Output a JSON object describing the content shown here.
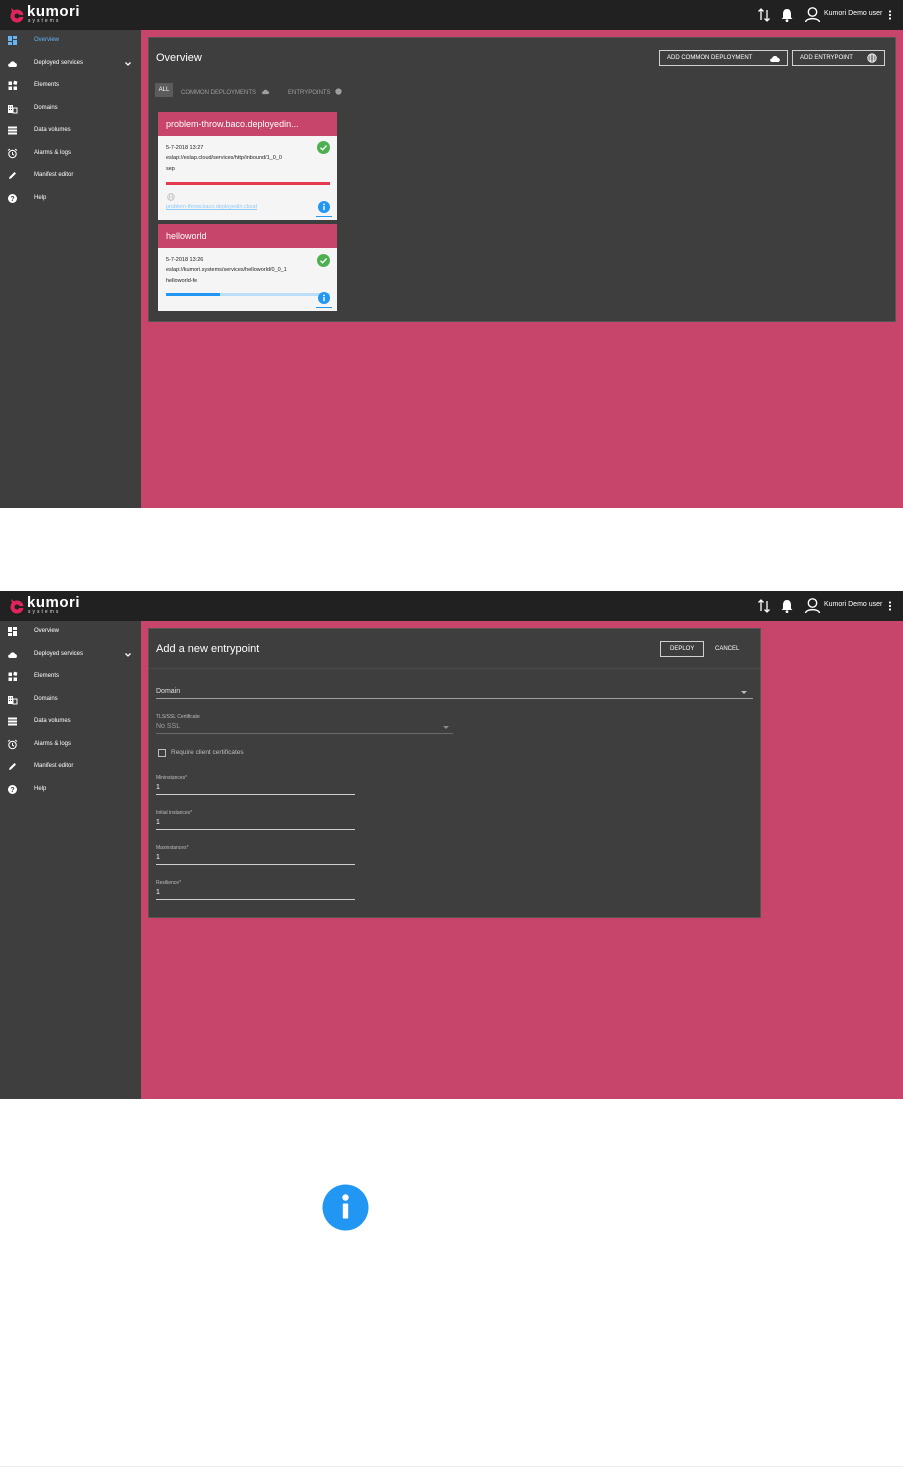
{
  "app": {
    "logo_text": "kumori",
    "logo_sub": "systems",
    "user_name": "Kumori Demo user",
    "accent_color": "#c7456a",
    "sidebar_color": "#3e3e3e",
    "topbar_color": "#212121",
    "success_color": "#4caf50",
    "info_color": "#2196f3",
    "error_color": "#e53950"
  },
  "sidebar": {
    "items": [
      {
        "label": "Overview",
        "icon": "dashboard-icon"
      },
      {
        "label": "Deployed services",
        "icon": "cloud-icon"
      },
      {
        "label": "Elements",
        "icon": "widgets-icon"
      },
      {
        "label": "Domains",
        "icon": "domain-icon"
      },
      {
        "label": "Data volumes",
        "icon": "storage-icon"
      },
      {
        "label": "Alarms & logs",
        "icon": "alarm-icon"
      },
      {
        "label": "Manifest editor",
        "icon": "pencil-icon"
      },
      {
        "label": "Help",
        "icon": "help-icon"
      }
    ]
  },
  "overview": {
    "title": "Overview",
    "add_common_label": "ADD COMMON DEPLOYMENT",
    "add_entrypoint_label": "ADD ENTRYPOINT",
    "filters": {
      "all": "ALL",
      "common": "COMMON DEPLOYMENTS",
      "entrypoints": "ENTRYPOINTS"
    },
    "cards": [
      {
        "title": "problem-throw.baco.deployedin...",
        "date": "5-7-2018 13:27",
        "service": "eslap://eslap.cloud/services/http/inbound/1_0_0",
        "role": "sep",
        "link": "problem-throw.baco.deployedin.cloud",
        "status": "ok",
        "progress": 1.0
      },
      {
        "title": "helloworld",
        "date": "5-7-2018 13:26",
        "service": "eslap://kumori.systems/services/helloworld/0_0_1",
        "role": "helloworld-fe",
        "status": "ok",
        "progress": 0.33
      }
    ]
  },
  "entrypoint_form": {
    "title": "Add a new entrypoint",
    "deploy_label": "DEPLOY",
    "cancel_label": "CANCEL",
    "domain_placeholder": "Domain",
    "tls_label": "TLS/SSL Certificate",
    "tls_value": "No SSL",
    "require_client_certs": "Require client certificates",
    "min_instances_label": "Mininstances*",
    "min_instances_value": "1",
    "initial_instances_label": "Initial instances*",
    "initial_instances_value": "1",
    "max_instances_label": "Maxinstances*",
    "max_instances_value": "1",
    "resilience_label": "Resilience*",
    "resilience_value": "1"
  }
}
